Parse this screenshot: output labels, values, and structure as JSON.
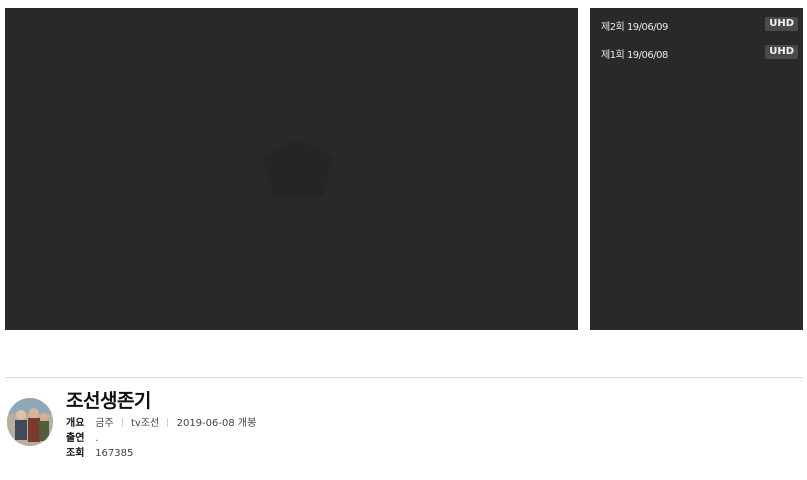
{
  "episodes": [
    {
      "label": "제2회 19/06/09",
      "quality": "UHD"
    },
    {
      "label": "제1회 19/06/08",
      "quality": "UHD"
    }
  ],
  "program": {
    "title": "조선생존기",
    "overview_label": "개요",
    "genre": "금주",
    "channel": "tv조선",
    "premiere": "2019-06-08 개봉",
    "cast_label": "출연",
    "cast": ".",
    "views_label": "조회",
    "views": "167385"
  },
  "icons": {
    "watermark": "broadcaster-logo-icon",
    "poster": "program-poster-icon"
  }
}
